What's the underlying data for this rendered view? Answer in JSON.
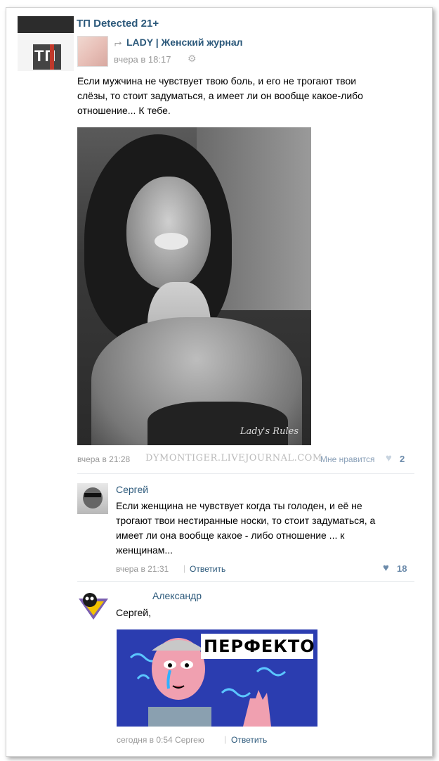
{
  "group": {
    "name": "ТП Detected 21+",
    "avatar_text": "ТП"
  },
  "repost": {
    "source": "LADY | Женский журнал",
    "time": "вчера в 18:17"
  },
  "post": {
    "text_lines": [
      "Если мужчина не чувствует твою боль, и его не трогают твои",
      "слёзы, то стоит задуматься, а имеет ли он вообще какое-либо",
      "отношение... К тебе."
    ],
    "image_watermark": "Lady's Rules",
    "time": "вчера в 21:28",
    "watermark": "DYMONTIGER.LIVEJOURNAL.COM",
    "like_label": "Мне нравится",
    "like_count": "2"
  },
  "comments": [
    {
      "author": "Сергей",
      "text_lines": [
        "Если женщина не чувствует когда ты голоден, и её не",
        "трогают твои нестиранные носки, то стоит задуматься, а",
        "имеет ли она вообще какое - либо отношение ... к",
        "женщинам..."
      ],
      "time": "вчера в 21:31",
      "reply_label": "Ответить",
      "likes": "18"
    },
    {
      "author": "Александр",
      "text": "Сергей,",
      "meme_text": "ПЕРФЕКТО!",
      "time": "сегодня в 0:54 Сергею",
      "reply_label": "Ответить"
    }
  ],
  "colors": {
    "link": "#2b587a",
    "muted": "#999999",
    "heart": "#a9bcd2"
  }
}
